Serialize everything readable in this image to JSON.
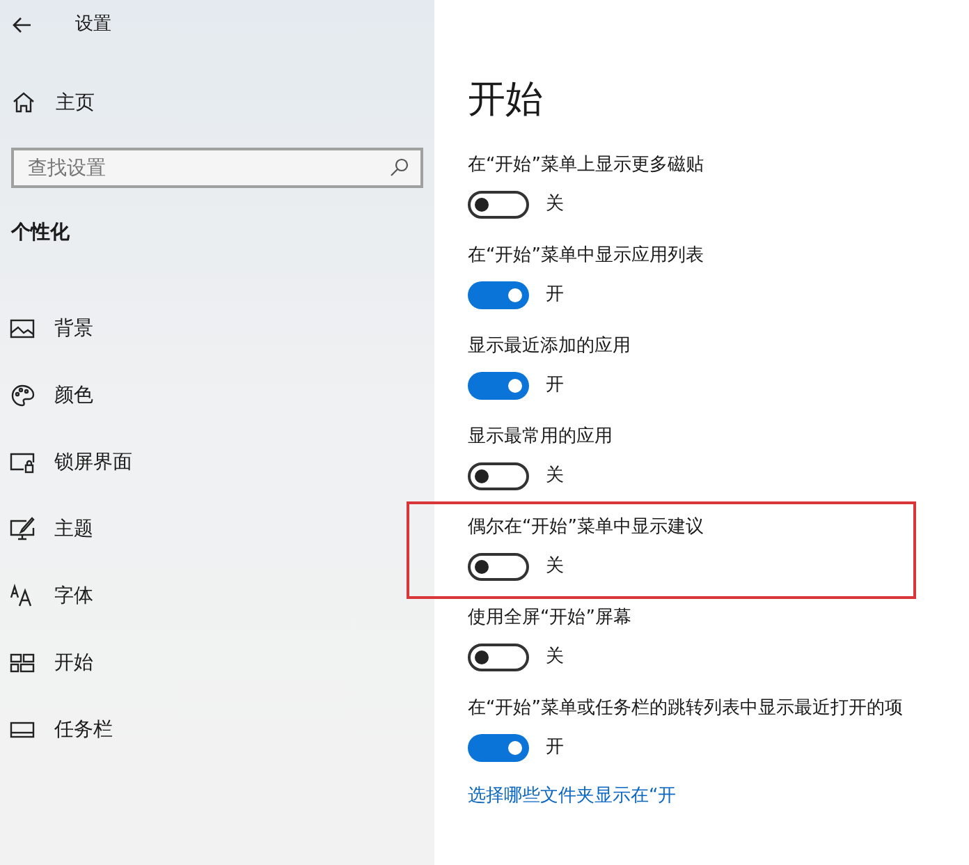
{
  "header": {
    "title": "设置"
  },
  "sidebar": {
    "home": "主页",
    "search": {
      "placeholder": "查找设置"
    },
    "section": "个性化",
    "items": [
      {
        "label": "背景"
      },
      {
        "label": "颜色"
      },
      {
        "label": "锁屏界面"
      },
      {
        "label": "主题"
      },
      {
        "label": "字体"
      },
      {
        "label": "开始"
      },
      {
        "label": "任务栏"
      }
    ]
  },
  "main": {
    "title": "开始",
    "toggles": [
      {
        "label": "在“开始”菜单上显示更多磁贴",
        "on": false,
        "state_text": "关",
        "highlighted": false
      },
      {
        "label": "在“开始”菜单中显示应用列表",
        "on": true,
        "state_text": "开",
        "highlighted": false
      },
      {
        "label": "显示最近添加的应用",
        "on": true,
        "state_text": "开",
        "highlighted": false
      },
      {
        "label": "显示最常用的应用",
        "on": false,
        "state_text": "关",
        "highlighted": false
      },
      {
        "label": "偶尔在“开始”菜单中显示建议",
        "on": false,
        "state_text": "关",
        "highlighted": true
      },
      {
        "label": "使用全屏“开始”屏幕",
        "on": false,
        "state_text": "关",
        "highlighted": false
      },
      {
        "label": "在“开始”菜单或任务栏的跳转列表中显示最近打开的项",
        "on": true,
        "state_text": "开",
        "highlighted": false
      }
    ],
    "link": "选择哪些文件夹显示在“开"
  }
}
